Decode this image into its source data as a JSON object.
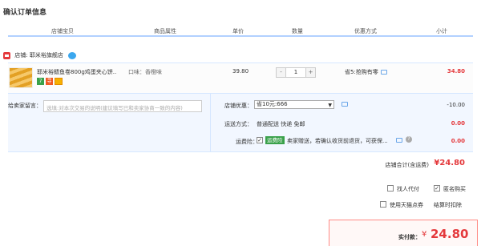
{
  "page_title": "确认订单信息",
  "columns": [
    "店铺宝贝",
    "商品属性",
    "单价",
    "数量",
    "优惠方式",
    "小计"
  ],
  "shop": {
    "label": "店铺:",
    "name": "耶米裕旗舰店"
  },
  "item": {
    "title": "耶米裕鳍鱼卷800g鸡蛋夹心饼...",
    "badges": [
      "7",
      "寻"
    ],
    "attribute": "口味：香橙味",
    "price": "39.80",
    "quantity": "1",
    "minus": "-",
    "plus": "+",
    "promotion": "省5:抢购有零",
    "subtotal": "34.80"
  },
  "message": {
    "label": "给卖家留言：",
    "placeholder": "选填:对本次交易的说明(建议填写已和卖家协商一致的内容)"
  },
  "coupon": {
    "label": "店铺优惠：",
    "selected": "省10元:666",
    "amount": "-10.00"
  },
  "shipping": {
    "label": "运送方式：",
    "value": "普通配送 快递 免邮",
    "amount": "0.00"
  },
  "insurance": {
    "label": "运费险：",
    "check": "✓",
    "tag": "运费险",
    "text": "卖家赠送，若确认收货前退货，可获保...",
    "help": "?",
    "amount": "0.00"
  },
  "shop_total": {
    "label": "店铺合计(含运费)",
    "amount": "¥24.80"
  },
  "options": {
    "pay_for_other": "找人代付",
    "anonymous": "匿名购买",
    "anonymous_check": "✓",
    "coupon_voucher": "使用天猫点券",
    "settle_detail": "结算时扣除"
  },
  "payment": {
    "label": "实付款：",
    "yen": "¥",
    "amount": "24.80"
  },
  "colors": {
    "accent": "#e4393c",
    "border": "#b2d1ff",
    "option_bg": "#f2f7ff"
  }
}
